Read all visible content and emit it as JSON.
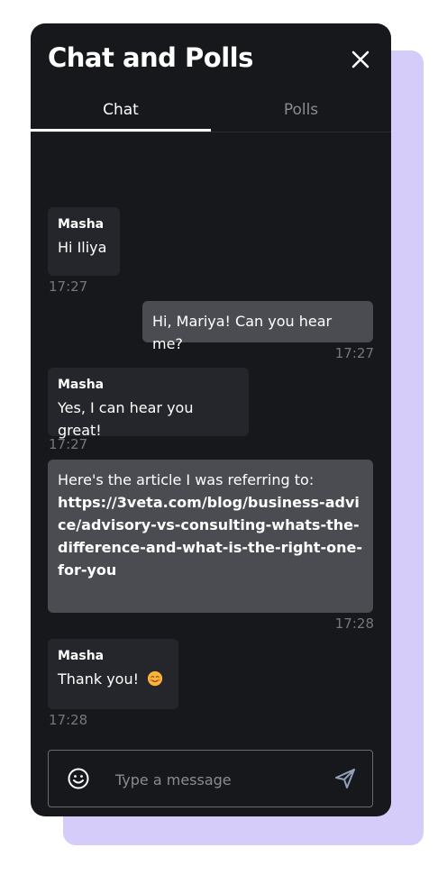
{
  "header": {
    "title": "Chat and Polls",
    "close_icon": "close-icon"
  },
  "tabs": [
    {
      "label": "Chat",
      "active": true
    },
    {
      "label": "Polls",
      "active": false
    }
  ],
  "messages": [
    {
      "direction": "in",
      "sender": "Masha",
      "text": "Hi Iliya",
      "time": "17:27"
    },
    {
      "direction": "out",
      "text": "Hi, Mariya! Can you hear me?",
      "time": "17:27"
    },
    {
      "direction": "in",
      "sender": "Masha",
      "text": "Yes, I can hear you great!",
      "time": "17:27"
    },
    {
      "direction": "out",
      "text": "Here's the article I was referring to:",
      "link": "https://3veta.com/blog/business-advice/advisory-vs-consulting-whats-the-difference-and-what-is-the-right-one-for-you",
      "time": "17:28"
    },
    {
      "direction": "in",
      "sender": "Masha",
      "text": "Thank you!",
      "emoji": "smiling-face-emoji",
      "time": "17:28"
    }
  ],
  "composer": {
    "placeholder": "Type a message",
    "value": "",
    "emoji_icon": "emoji-icon",
    "send_icon": "send-icon"
  },
  "colors": {
    "panel_bg": "#17181c",
    "incoming_bubble": "#25262b",
    "outgoing_bubble": "#4b4c52",
    "backdrop": "#d5ccfa",
    "timestamp": "#76777c"
  }
}
